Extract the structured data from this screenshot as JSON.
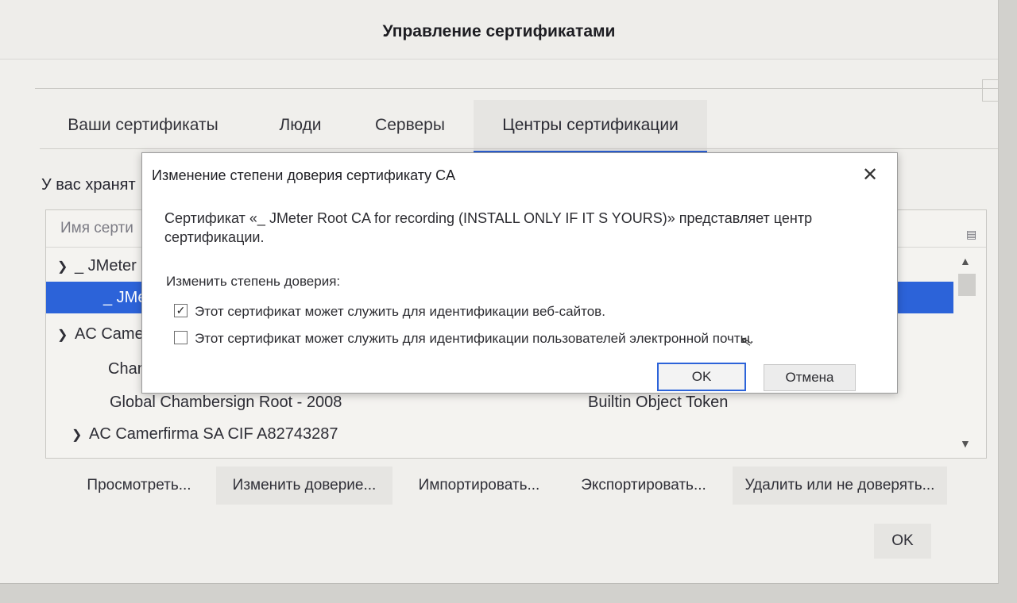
{
  "window": {
    "title": "Управление сертификатами"
  },
  "tabs": [
    {
      "label": "Ваши сертификаты"
    },
    {
      "label": "Люди"
    },
    {
      "label": "Серверы"
    },
    {
      "label": "Центры сертификации"
    }
  ],
  "storage_text": "У вас хранят",
  "tree": {
    "column_name": "Имя серти",
    "column_picker_icon": "column-picker-icon",
    "rows": [
      {
        "label": "_ JMeter",
        "expanded": true,
        "level": 0
      },
      {
        "label": "_ JMet",
        "level": 1,
        "selected": true
      },
      {
        "label": "AC Came",
        "expanded": true,
        "level": 0
      },
      {
        "label": "Chaml",
        "level": 1
      },
      {
        "label": "Global Chambersign Root - 2008",
        "token": "Builtin Object Token",
        "level": 1
      },
      {
        "label": "AC Camerfirma SA CIF A82743287",
        "expanded": true,
        "level": 0
      }
    ]
  },
  "buttons": {
    "view": "Просмотреть...",
    "edit_trust": "Изменить доверие...",
    "import": "Импортировать...",
    "export": "Экспортировать...",
    "delete": "Удалить или не доверять...",
    "ok": "OK"
  },
  "dialog": {
    "title": "Изменение степени доверия сертификату CA",
    "message": "Сертификат «_ JMeter Root CA for recording (INSTALL ONLY IF IT S YOURS)» представляет центр сертификации.",
    "label": "Изменить степень доверия:",
    "checkboxes": [
      {
        "label": "Этот сертификат может служить для идентификации веб-сайтов.",
        "checked": true
      },
      {
        "label": "Этот сертификат может служить для идентификации пользователей электронной почты.",
        "checked": false
      }
    ],
    "ok": "OK",
    "cancel": "Отмена"
  },
  "colors": {
    "accent": "#2c63d9",
    "selected_row": "#2c63d9"
  }
}
